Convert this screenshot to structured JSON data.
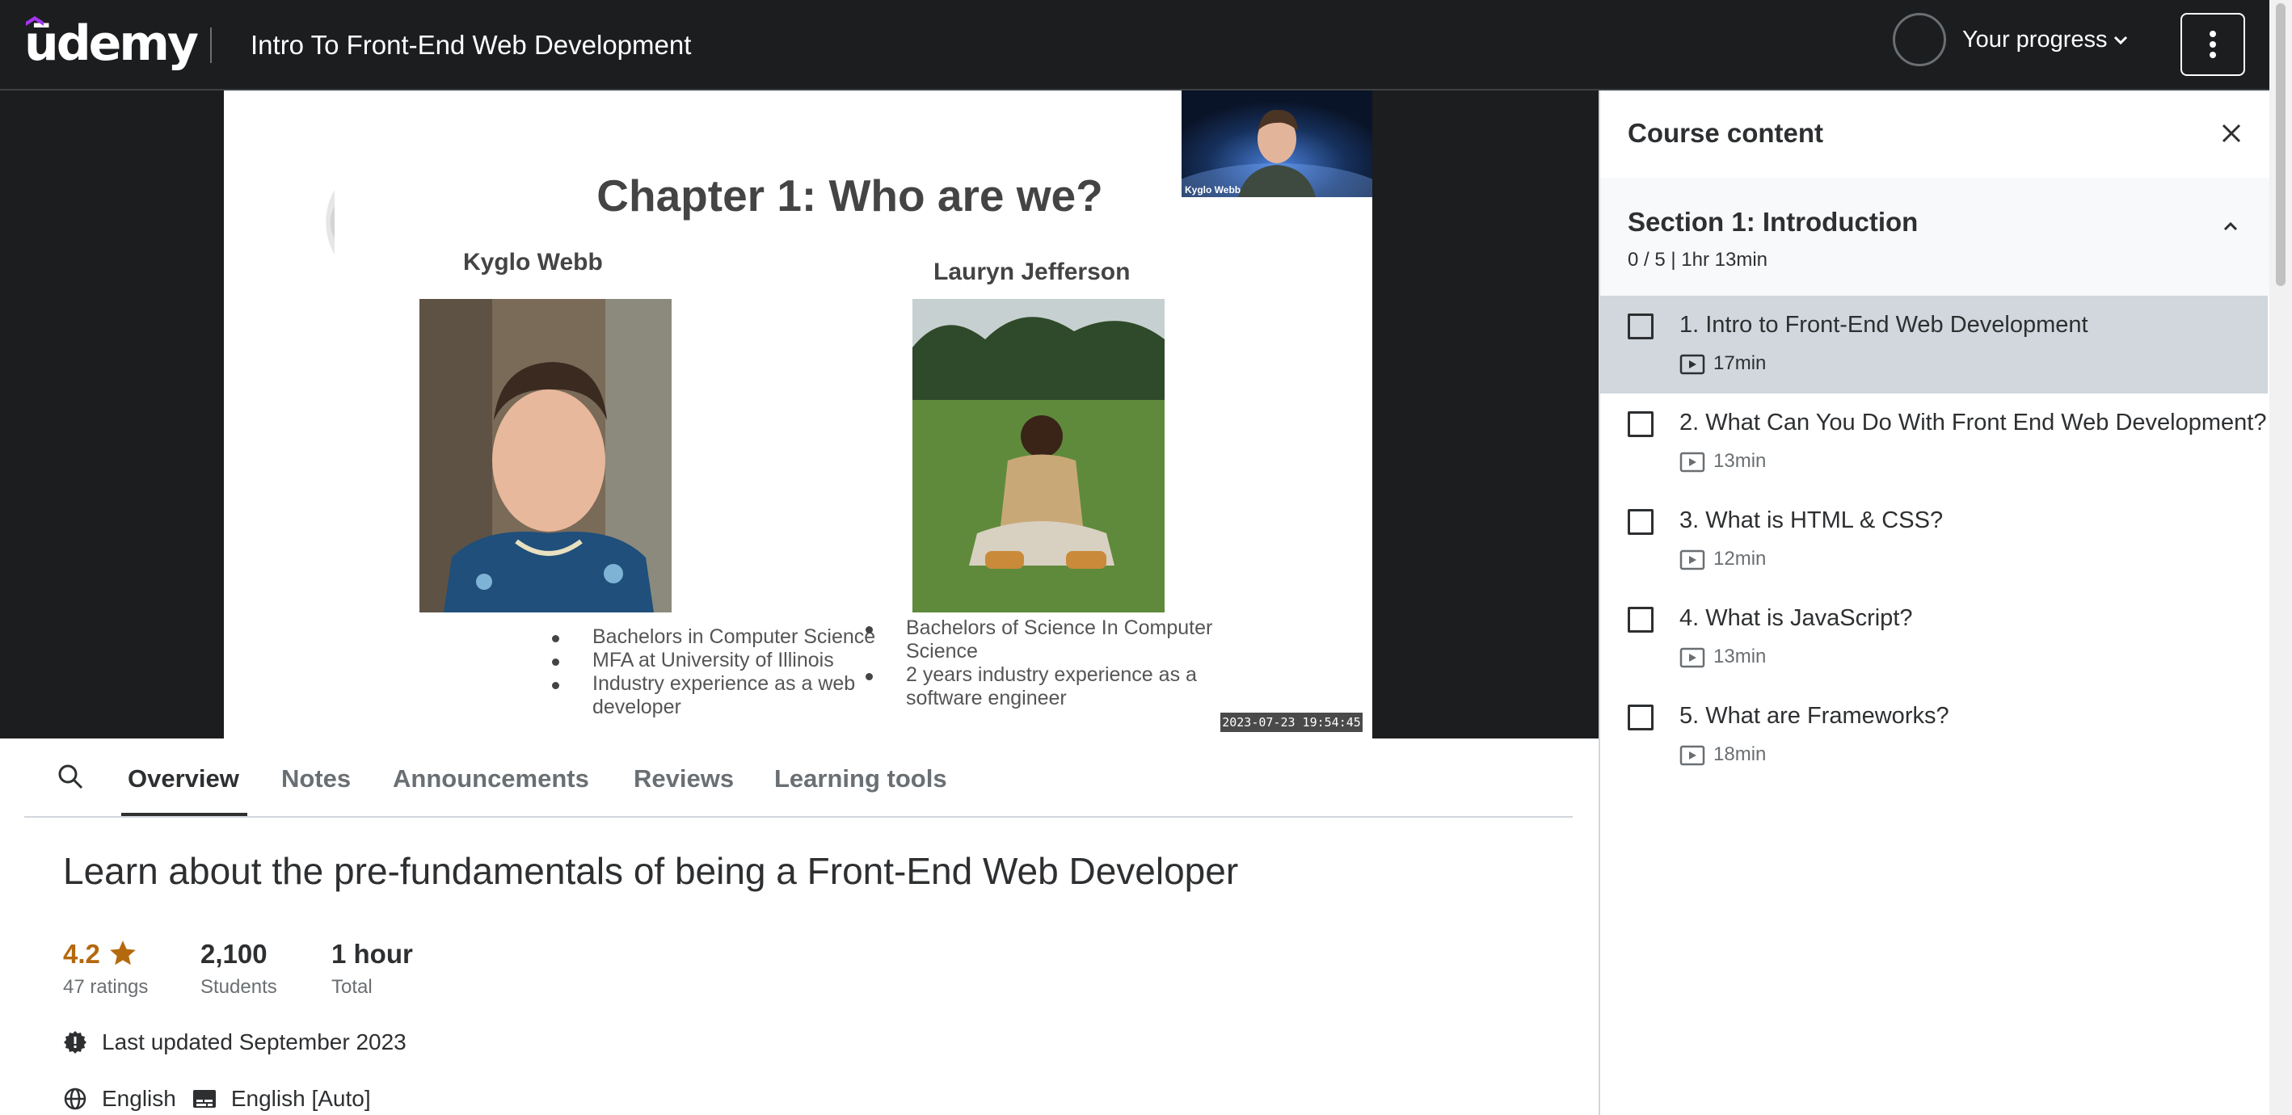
{
  "header": {
    "logo": "ūdemy",
    "course_title": "Intro To Front-End Web Development",
    "progress_label": "Your progress"
  },
  "video": {
    "slide_title": "Chapter 1: Who are we?",
    "presenter_caption": "Kyglo Webb",
    "timestamp": "2023-07-23 19:54:45",
    "people": [
      {
        "name": "Kyglo Webb",
        "bullets": [
          "Bachelors in Computer Science",
          "MFA at University of Illinois",
          "Industry experience as a web developer"
        ]
      },
      {
        "name": "Lauryn Jefferson",
        "bullets": [
          "Bachelors of Science In Computer Science",
          "2 years industry experience as a software engineer"
        ]
      }
    ]
  },
  "tabs": [
    {
      "label": "Overview",
      "active": true
    },
    {
      "label": "Notes",
      "active": false
    },
    {
      "label": "Announcements",
      "active": false
    },
    {
      "label": "Reviews",
      "active": false
    },
    {
      "label": "Learning tools",
      "active": false
    }
  ],
  "overview": {
    "heading": "Learn about the pre-fundamentals of being a Front-End Web Developer",
    "rating": {
      "value": "4.2",
      "label": "47 ratings"
    },
    "students": {
      "value": "2,100",
      "label": "Students"
    },
    "duration": {
      "value": "1 hour",
      "label": "Total"
    },
    "last_updated": "Last updated September 2023",
    "language": "English",
    "captions": "English [Auto]"
  },
  "sidebar": {
    "title": "Course content",
    "section": {
      "title": "Section 1: Introduction",
      "meta": "0 / 5 | 1hr 13min",
      "lectures": [
        {
          "title": "1. Intro to Front-End Web Development",
          "duration": "17min",
          "current": true,
          "completed": false
        },
        {
          "title": "2. What Can You Do With Front End Web Development?",
          "duration": "13min",
          "current": false,
          "completed": false
        },
        {
          "title": "3. What is HTML & CSS?",
          "duration": "12min",
          "current": false,
          "completed": false
        },
        {
          "title": "4. What is JavaScript?",
          "duration": "13min",
          "current": false,
          "completed": false
        },
        {
          "title": "5. What are Frameworks?",
          "duration": "18min",
          "current": false,
          "completed": false
        }
      ]
    }
  },
  "colors": {
    "topbar_bg": "#1c1d1f",
    "brand_purple": "#a435f0",
    "rating_orange": "#b4690e",
    "current_lecture_bg": "#d1d7dc"
  }
}
